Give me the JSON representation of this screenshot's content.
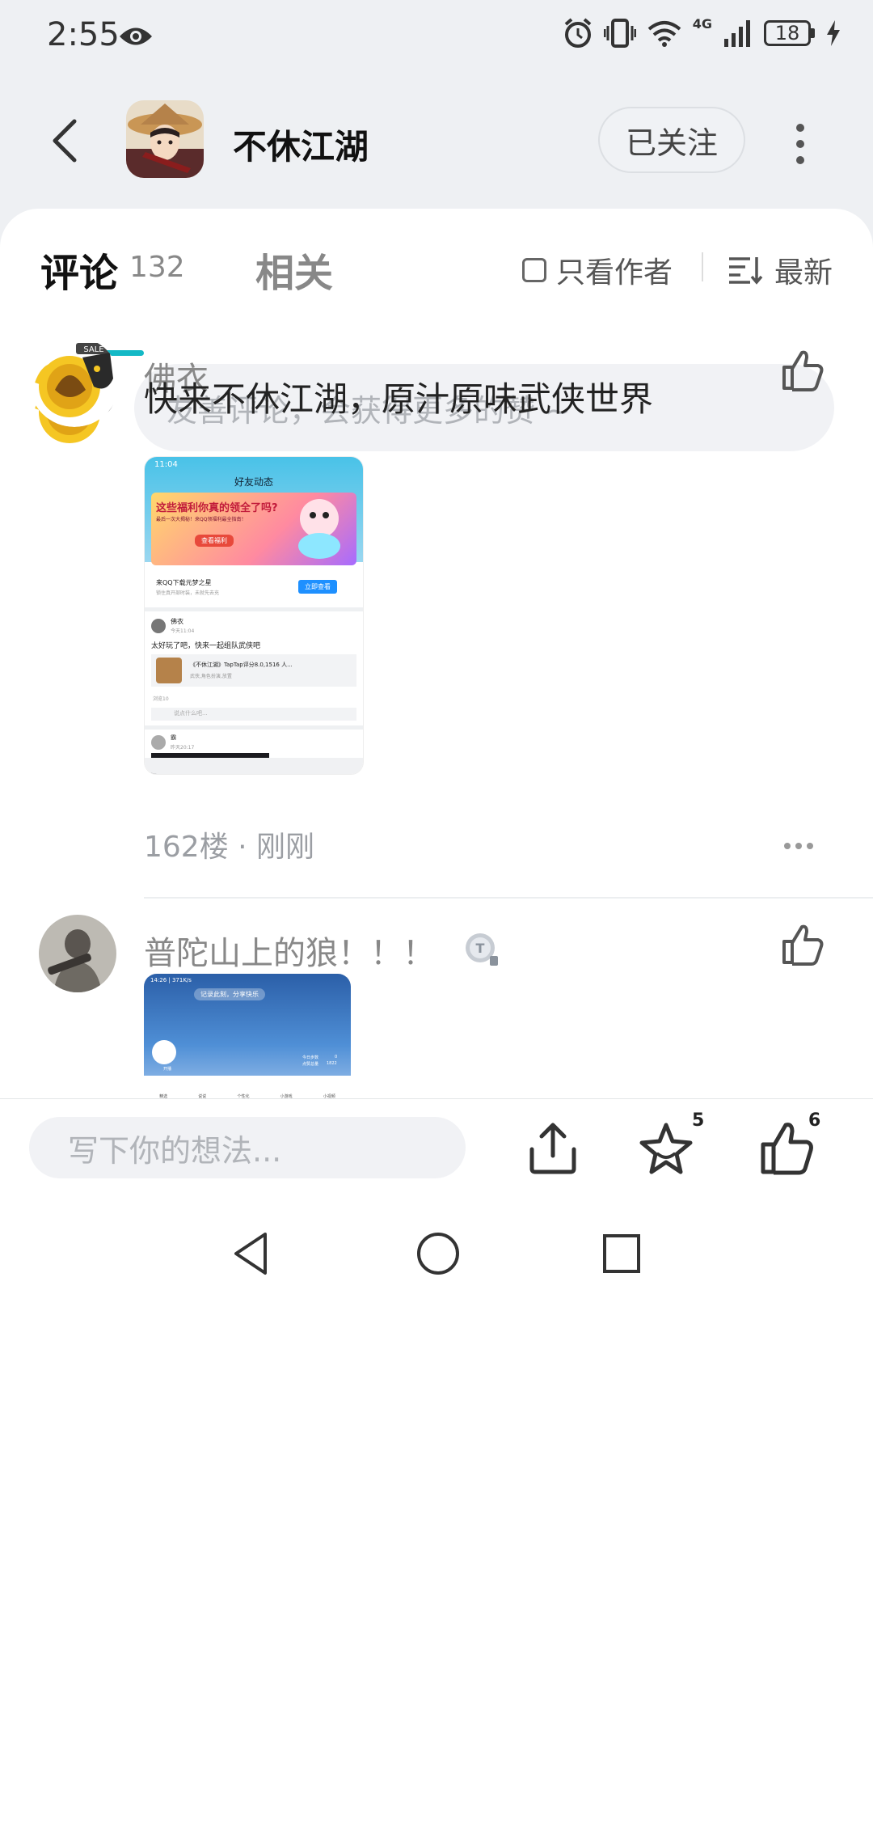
{
  "status_bar": {
    "time": "2:55",
    "battery": "18"
  },
  "header": {
    "app_title": "不休江湖",
    "follow_label": "已关注"
  },
  "tabs": {
    "comment_label": "评论",
    "comment_count": "132",
    "related_label": "相关",
    "only_author_label": "只看作者",
    "sort_label": "最新"
  },
  "comment_input": {
    "placeholder": "友善评论，会获得更多的赞 ~"
  },
  "comments": [
    {
      "username": "佛衣",
      "text": "快来不休江湖，原汁原味武侠世界",
      "meta": "162楼 · 刚刚",
      "screenshot": {
        "time": "11:04",
        "header": "好友动态",
        "banner": "这些福利你真的领全了吗?",
        "banner_sub": "最后一次大揭秘！来QQ领福利最全指南！",
        "banner_button": "查看福利",
        "ad_title": "来QQ下载元梦之星",
        "ad_sub": "锁住真开部时装，未就先去充",
        "ad_button": "立即查看",
        "post_user": "佛衣",
        "post_time": "今天11:04",
        "post_text": "太好玩了吧，快来一起组队武侠吧",
        "link_title": "《不休江湖》TapTap评分8.0,1516 人...",
        "link_sub": "武侠,角色扮演,放置",
        "views": "浏览10",
        "reply_placeholder": "说点什么吧...",
        "post2_user": "霸",
        "post2_time": "昨天20:17"
      }
    },
    {
      "username": "普陀山上的狼！！！",
      "badge": "T",
      "screenshot": {
        "status": "14:26 | 371K/s",
        "banner": "记录此刻，分享快乐",
        "stat1": "今日步数",
        "stat1_val": "0",
        "stat2": "点赞总量",
        "stat2_val": "1822",
        "nav": [
          "精选",
          "说说",
          "个性化",
          "小游戏",
          "小视频"
        ],
        "avatar_tag": "开播"
      }
    }
  ],
  "bottom_bar": {
    "placeholder": "写下你的想法...",
    "star_count": "5",
    "like_count": "6"
  },
  "colors": {
    "accent": "#14b9c6",
    "sheet": "#ffffff",
    "background": "#eef0f3"
  }
}
